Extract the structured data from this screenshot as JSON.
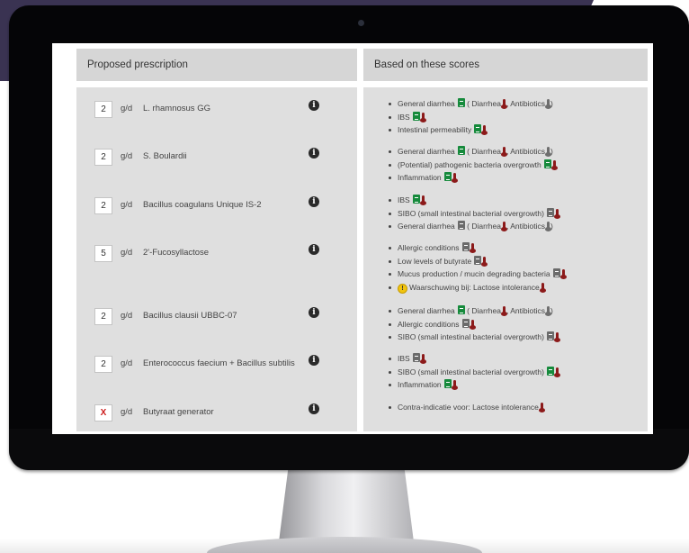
{
  "columns": {
    "left_header": "Proposed prescription",
    "right_header": "Based on these scores"
  },
  "prescriptions": [
    {
      "dose": "2",
      "unit": "g/d",
      "name": "L. rhamnosus GG"
    },
    {
      "dose": "2",
      "unit": "g/d",
      "name": "S. Boulardii"
    },
    {
      "dose": "2",
      "unit": "g/d",
      "name": "Bacillus coagulans Unique IS-2"
    },
    {
      "dose": "5",
      "unit": "g/d",
      "name": "2'-Fucosyllactose"
    },
    {
      "dose": "2",
      "unit": "g/d",
      "name": "Bacillus clausii UBBC-07"
    },
    {
      "dose": "2",
      "unit": "g/d",
      "name": "Enterococcus faecium + Bacillus subtilis"
    },
    {
      "dose": "X",
      "unit": "g/d",
      "name": "Butyraat generator"
    }
  ],
  "scores": {
    "g1": {
      "i1": {
        "text": "General diarrhea",
        "open": "( Diarrhea",
        "comma": ", Antibiotics",
        "close": ")"
      },
      "i2": {
        "text": "IBS"
      },
      "i3": {
        "text": "Intestinal permeability"
      }
    },
    "g2": {
      "i1": {
        "text": "General diarrhea",
        "open": "( Diarrhea",
        "comma": ", Antibiotics",
        "close": ")"
      },
      "i2": {
        "text": "(Potential) pathogenic bacteria overgrowth"
      },
      "i3": {
        "text": "Inflammation"
      }
    },
    "g3": {
      "i1": {
        "text": "IBS"
      },
      "i2": {
        "text": "SIBO (small intestinal bacterial overgrowth)"
      },
      "i3": {
        "text": "General diarrhea",
        "open": "( Diarrhea",
        "comma": ", Antibiotics",
        "close": ")"
      }
    },
    "g4": {
      "i1": {
        "text": "Allergic conditions"
      },
      "i2": {
        "text": "Low levels of butyrate"
      },
      "i3": {
        "text": "Mucus production / mucin degrading bacteria"
      },
      "i4": {
        "text": "Waarschuwing bij: Lactose intolerance",
        "warn": "!"
      }
    },
    "g5": {
      "i1": {
        "text": "General diarrhea",
        "open": "( Diarrhea",
        "comma": ", Antibiotics",
        "close": ")"
      },
      "i2": {
        "text": "Allergic conditions"
      },
      "i3": {
        "text": "SIBO (small intestinal bacterial overgrowth)"
      }
    },
    "g6": {
      "i1": {
        "text": "IBS"
      },
      "i2": {
        "text": "SIBO (small intestinal bacterial overgrowth)"
      },
      "i3": {
        "text": "Inflammation"
      }
    },
    "g7": {
      "i1": {
        "text": "Contra-indicatie voor: Lactose intolerance"
      }
    }
  },
  "icons": {
    "info": "i",
    "document": "document-icon",
    "thermometer": "thermometer-icon",
    "warning": "warning-icon"
  },
  "colors": {
    "doc_green": "#168a3c",
    "doc_gray": "#6b6b6b",
    "thermo_red": "#8c1a1a",
    "thermo_gray": "#6e6e6e",
    "header_bg": "#d6d6d6",
    "body_bg": "#dfdfdf",
    "dose_x": "#cc1b1b",
    "warn_yellow": "#f1c40f"
  }
}
